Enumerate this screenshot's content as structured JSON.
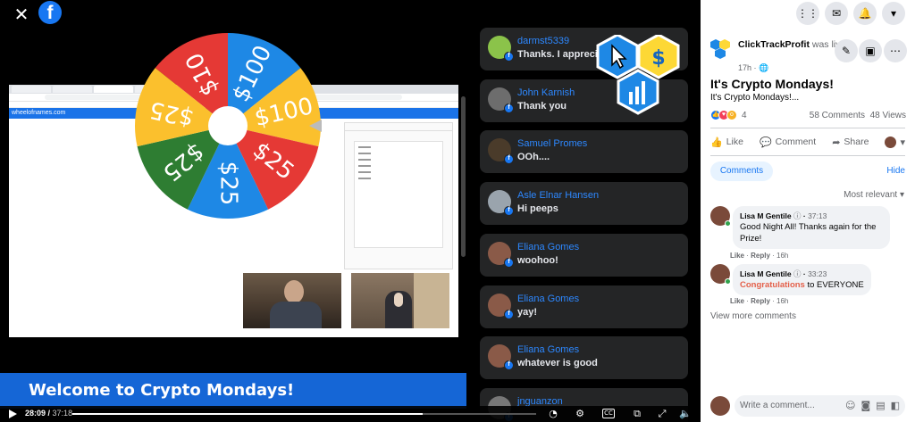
{
  "video": {
    "welcome_banner": "Welcome to Crypto Mondays!",
    "site_url": "wheelofnames.com",
    "wheel_segments": [
      {
        "label": "$10",
        "color": "#e53935"
      },
      {
        "label": "$100",
        "color": "#1e88e5"
      },
      {
        "label": "$100",
        "color": "#fbc02d"
      },
      {
        "label": "$25",
        "color": "#e53935"
      },
      {
        "label": "$25",
        "color": "#1e88e5"
      },
      {
        "label": "$25",
        "color": "#2e7d32"
      },
      {
        "label": "$25",
        "color": "#fbc02d"
      }
    ]
  },
  "overlay_comments": [
    {
      "name": "darmst5339",
      "text": "Thanks. I apprecia",
      "avatar_color": "#8bc34a"
    },
    {
      "name": "John Karnish",
      "text": "Thank you",
      "avatar_color": "#6d6d6d"
    },
    {
      "name": "Samuel Promes",
      "text": "OOh....",
      "avatar_color": "#4a3b2a"
    },
    {
      "name": "Asle Elnar Hansen",
      "text": "Hi peeps",
      "avatar_color": "#9aa4ad"
    },
    {
      "name": "Eliana Gomes",
      "text": "woohoo!",
      "avatar_color": "#8a5a48"
    },
    {
      "name": "Eliana Gomes",
      "text": "yay!",
      "avatar_color": "#8a5a48"
    },
    {
      "name": "Eliana Gomes",
      "text": "whatever is good",
      "avatar_color": "#8a5a48"
    },
    {
      "name": "jnguanzon",
      "text": "",
      "avatar_color": "#777777"
    }
  ],
  "player": {
    "current_time": "28:09",
    "duration": "37:18",
    "progress_fraction": 0.755
  },
  "sidebar": {
    "author": "ClickTrackProfit",
    "author_status": "was live.",
    "post_time": "17h",
    "title": "It's Crypto Mondays!",
    "description": "It's Crypto Mondays!...",
    "reaction_count": "4",
    "comments_count": "58 Comments",
    "views_count": "48 Views",
    "like_label": "Like",
    "comment_label": "Comment",
    "share_label": "Share",
    "comments_tab": "Comments",
    "hide_label": "Hide",
    "sort_label": "Most relevant",
    "view_more": "View more comments",
    "write_placeholder": "Write a comment...",
    "comments": [
      {
        "name": "Lisa M Gentile",
        "time": "37:13",
        "text": "Good Night All! Thanks again for the Prize!",
        "like": "Like",
        "reply": "Reply",
        "age": "16h"
      },
      {
        "name": "Lisa M Gentile",
        "time": "33:23",
        "highlight": "Congratulations",
        "text": " to EVERYONE",
        "like": "Like",
        "reply": "Reply",
        "age": "16h"
      }
    ]
  },
  "colors": {
    "fb_blue": "#1877f2",
    "link_blue": "#2d88ff",
    "banner_blue": "#1566d6",
    "dark_card": "#242526"
  }
}
